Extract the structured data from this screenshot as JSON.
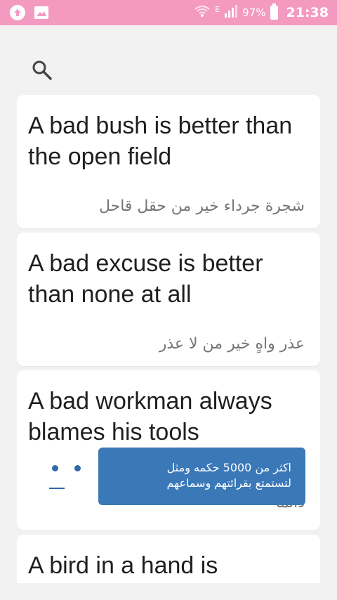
{
  "status_bar": {
    "network": "E",
    "battery": "97%",
    "time": "21:38",
    "icons": [
      "upload-icon",
      "image-icon",
      "wifi-icon",
      "signal-icon",
      "battery-icon"
    ]
  },
  "search": {
    "icon": "search-icon"
  },
  "cards": [
    {
      "english": "A bad bush is better than the open field",
      "arabic": "شجرة جرداء خير من حقل قاحل"
    },
    {
      "english": "A bad excuse is better than none at all",
      "arabic": "عذر واهٍ خير من لا عذر"
    },
    {
      "english": "A bad workman always blames his tools",
      "arabic": "دائما"
    },
    {
      "english": "A bird in a hand is",
      "arabic": ""
    }
  ],
  "promo_toast": {
    "line1": "اكثر من 5000 حكمه ومثل",
    "line2": "لتستمتع بقرائتهم وسماعهم"
  },
  "colors": {
    "status_bar": "#f49ac1",
    "toast": "#3a78b8",
    "background": "#f2f2f2"
  }
}
